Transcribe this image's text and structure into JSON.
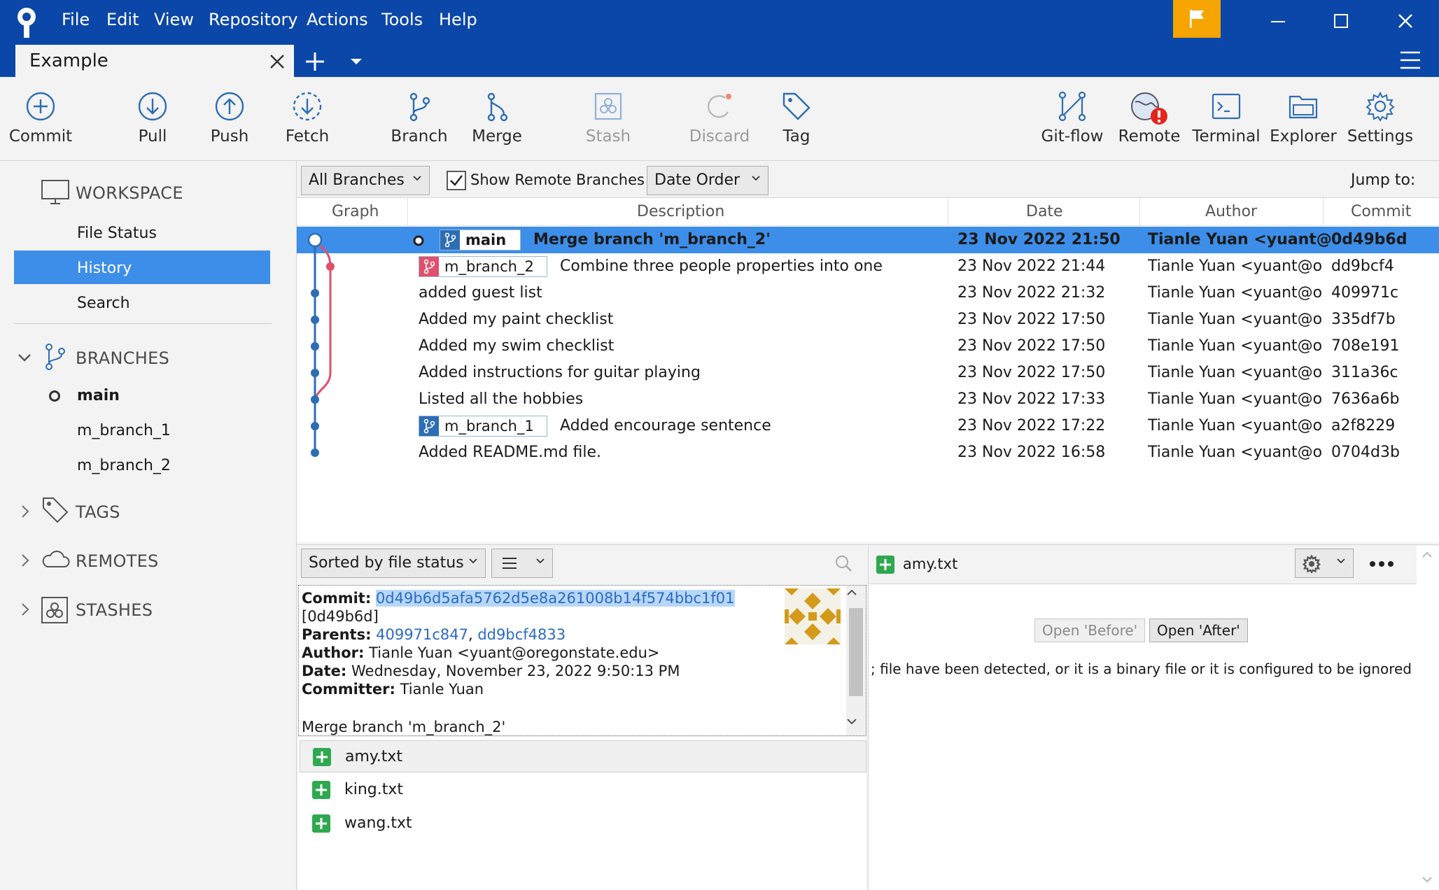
{
  "menu": [
    "File",
    "Edit",
    "View",
    "Repository",
    "Actions",
    "Tools",
    "Help"
  ],
  "tab": {
    "title": "Example"
  },
  "toolbar": {
    "commit": "Commit",
    "pull": "Pull",
    "push": "Push",
    "fetch": "Fetch",
    "branch": "Branch",
    "merge": "Merge",
    "stash": "Stash",
    "discard": "Discard",
    "tag": "Tag",
    "gitflow": "Git-flow",
    "remote": "Remote",
    "terminal": "Terminal",
    "explorer": "Explorer",
    "settings": "Settings"
  },
  "sidebar": {
    "workspace": "WORKSPACE",
    "file_status": "File Status",
    "history": "History",
    "search": "Search",
    "branches": "BRANCHES",
    "branch_items": [
      "main",
      "m_branch_1",
      "m_branch_2"
    ],
    "tags": "TAGS",
    "remotes": "REMOTES",
    "stashes": "STASHES"
  },
  "filter": {
    "branches": "All Branches",
    "show_remote": "Show Remote Branches",
    "order": "Date Order",
    "jump_to": "Jump to:"
  },
  "columns": {
    "graph": "Graph",
    "description": "Description",
    "date": "Date",
    "author": "Author",
    "commit": "Commit"
  },
  "commits": [
    {
      "branch": "main",
      "desc": "Merge branch 'm_branch_2'",
      "date": "23 Nov 2022 21:50",
      "author": "Tianle Yuan <yuant@",
      "hash": "0d49b6d"
    },
    {
      "branch": "m_branch_2",
      "desc": "Combine three people properties into one",
      "date": "23 Nov 2022 21:44",
      "author": "Tianle Yuan <yuant@o",
      "hash": "dd9bcf4"
    },
    {
      "branch": "",
      "desc": "added guest list",
      "date": "23 Nov 2022 21:32",
      "author": "Tianle Yuan <yuant@o",
      "hash": "409971c"
    },
    {
      "branch": "",
      "desc": "Added my paint checklist",
      "date": "23 Nov 2022 17:50",
      "author": "Tianle Yuan <yuant@o",
      "hash": "335df7b"
    },
    {
      "branch": "",
      "desc": "Added my swim checklist",
      "date": "23 Nov 2022 17:50",
      "author": "Tianle Yuan <yuant@o",
      "hash": "708e191"
    },
    {
      "branch": "",
      "desc": "Added instructions for guitar playing",
      "date": "23 Nov 2022 17:50",
      "author": "Tianle Yuan <yuant@o",
      "hash": "311a36c"
    },
    {
      "branch": "",
      "desc": "Listed all the hobbies",
      "date": "23 Nov 2022 17:33",
      "author": "Tianle Yuan <yuant@o",
      "hash": "7636a6b"
    },
    {
      "branch": "m_branch_1",
      "desc": "Added encourage sentence",
      "date": "23 Nov 2022 17:22",
      "author": "Tianle Yuan <yuant@o",
      "hash": "a2f8229"
    },
    {
      "branch": "",
      "desc": "Added README.md file.",
      "date": "23 Nov 2022 16:58",
      "author": "Tianle Yuan <yuant@o",
      "hash": "0704d3b"
    }
  ],
  "details": {
    "sort": "Sorted by file status",
    "commit_label": "Commit:",
    "commit_full": "0d49b6d5afa5762d5e8a261008b14f574bbc1f01",
    "commit_short": "[0d49b6d]",
    "parents_label": "Parents:",
    "parent1": "409971c847",
    "parent_sep": ",",
    "parent2": "dd9bcf4833",
    "author_label": "Author:",
    "author": "Tianle Yuan <yuant@oregonstate.edu>",
    "date_label": "Date:",
    "date": "Wednesday, November 23, 2022 9:50:13 PM",
    "committer_label": "Committer:",
    "committer": "Tianle Yuan",
    "message": "Merge branch 'm_branch_2'"
  },
  "files": [
    "amy.txt",
    "king.txt",
    "wang.txt"
  ],
  "diff": {
    "file": "amy.txt",
    "open_before": "Open 'Before'",
    "open_after": "Open 'After'",
    "message": "; file have been detected, or it is a binary file or it is configured to be ignored b"
  },
  "colors": {
    "titlebar": "#0b47a8",
    "selection": "#3d8ee8",
    "main_line": "#2c6db5",
    "branch2_line": "#e0506b",
    "added": "#2fa84f",
    "flag": "#f5a400"
  }
}
